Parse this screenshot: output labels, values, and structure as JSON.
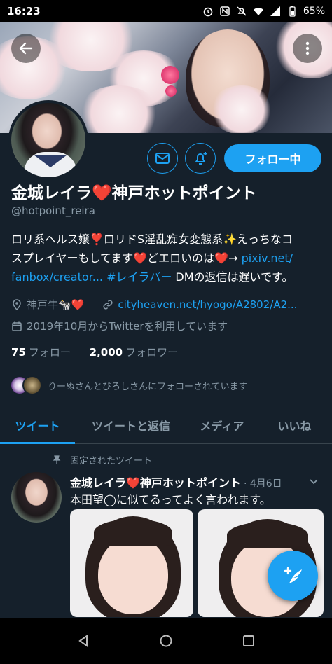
{
  "status_bar": {
    "time": "16:23",
    "battery": "65%"
  },
  "profile": {
    "name": "金城レイラ❤️神戸ホットポイント",
    "handle": "@hotpoint_reira",
    "follow_button": "フォロー中",
    "bio_line1": "ロリ系ヘルス嬢❣️ロリドS淫乱痴女変態系✨えっちなコ",
    "bio_line2a": "スプレイヤーもしてます❤️どエロいのは❤️→ ",
    "bio_link1": "pixiv.net/",
    "bio_link2": "fanbox/creator...",
    "bio_hashtag": "#レイラバー",
    "bio_tail": " DMの返信は遅いです。",
    "location": "神戸牛🐄❤️",
    "website": "cityheaven.net/hyogo/A2802/A2...",
    "joined": "2019年10月からTwitterを利用しています",
    "following_count": "75",
    "following_label": "フォロー",
    "followers_count": "2,000",
    "followers_label": "フォロワー",
    "followed_by": "りーぬさんとぴろしさんにフォローされています"
  },
  "tabs": [
    "ツイート",
    "ツイートと返信",
    "メディア",
    "いいね"
  ],
  "tweet": {
    "pinned_label": "固定されたツイート",
    "name": "金城レイラ❤️神戸ホットポイント",
    "date": "· 4月6日",
    "text": "本田望◯に似てるってよく言われます。"
  },
  "icons": [
    "back-arrow-icon",
    "more-vertical-icon",
    "mail-icon",
    "bell-plus-icon",
    "location-pin-icon",
    "link-icon",
    "calendar-icon",
    "pin-icon",
    "chevron-down-icon",
    "compose-icon"
  ],
  "colors": {
    "accent": "#1da1f2",
    "background": "#15202b",
    "secondary_text": "#8899a6",
    "divider": "#38444d"
  }
}
